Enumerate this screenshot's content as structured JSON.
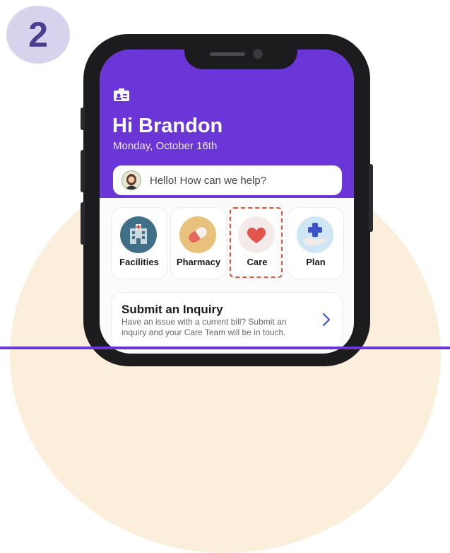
{
  "step": {
    "number": "2"
  },
  "header": {
    "greeting": "Hi Brandon",
    "date": "Monday, October 16th",
    "profile_icon": "id-card-icon"
  },
  "help": {
    "text": "Hello! How can we help?",
    "avatar_icon": "agent-avatar"
  },
  "tiles": [
    {
      "label": "Facilities",
      "icon": "building-icon"
    },
    {
      "label": "Pharmacy",
      "icon": "pill-icon"
    },
    {
      "label": "Care",
      "icon": "heart-icon"
    },
    {
      "label": "Plan",
      "icon": "hand-plus-icon"
    }
  ],
  "inquiry": {
    "title": "Submit an Inquiry",
    "body": "Have an issue with a current bill? Submit an inquiry and your Care Team will be in touch."
  },
  "colors": {
    "brand": "#6a36d8",
    "highlight": "#e0533b"
  }
}
